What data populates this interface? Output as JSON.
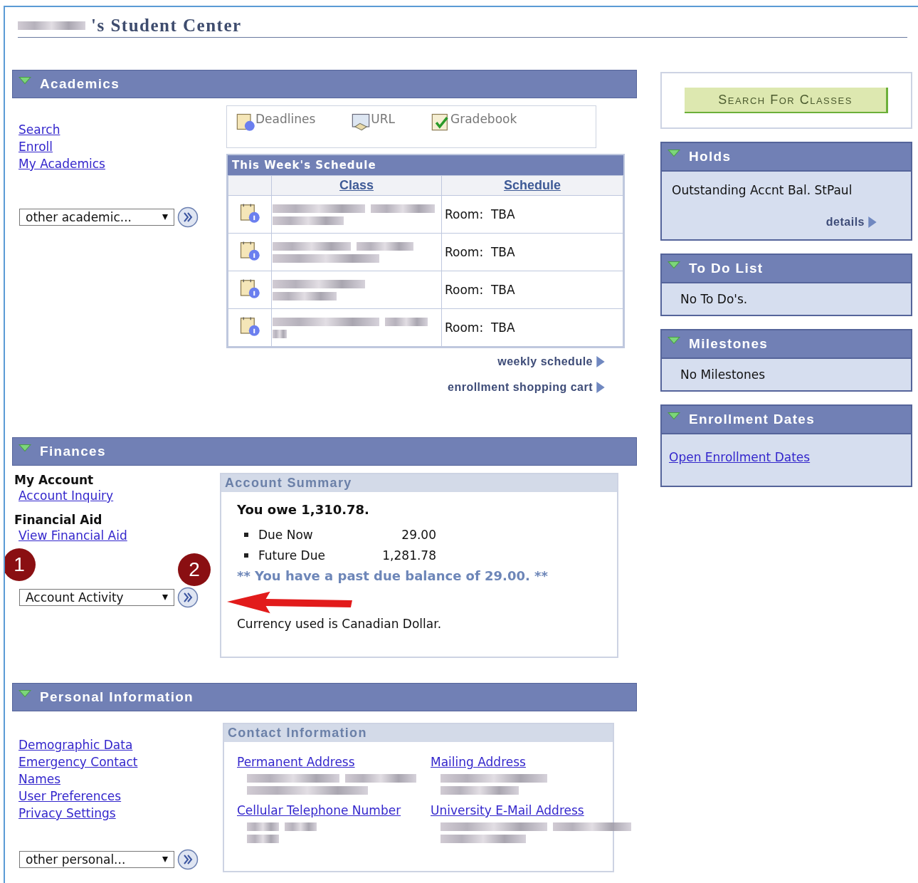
{
  "title": "'s Student Center",
  "academics": {
    "heading": "Academics",
    "links": [
      "Search",
      "Enroll",
      "My Academics"
    ],
    "dropdown": "other academic...",
    "toolbar": [
      {
        "kind": "deadlines",
        "label": "Deadlines"
      },
      {
        "kind": "url",
        "label": "URL"
      },
      {
        "kind": "gradebook",
        "label": "Gradebook"
      }
    ],
    "schedule": {
      "title": "This Week's Schedule",
      "columns": [
        "Class",
        "Schedule"
      ],
      "rows": [
        {
          "schedule": "Room:  TBA"
        },
        {
          "schedule": "Room:  TBA"
        },
        {
          "schedule": "Room:  TBA"
        },
        {
          "schedule": "Room:  TBA"
        }
      ]
    },
    "more_links": [
      "weekly schedule",
      "enrollment shopping cart"
    ]
  },
  "finances": {
    "heading": "Finances",
    "groups": [
      {
        "title": "My Account",
        "link": "Account Inquiry"
      },
      {
        "title": "Financial Aid",
        "link": "View Financial Aid"
      }
    ],
    "dropdown": "Account Activity",
    "summary": {
      "title": "Account Summary",
      "owe": "You owe 1,310.78.",
      "items": [
        {
          "label": "Due Now",
          "amount": "29.00"
        },
        {
          "label": "Future Due",
          "amount": "1,281.78"
        }
      ],
      "warning": "** You have a past due balance of 29.00. **",
      "currency": "Currency used is Canadian Dollar."
    }
  },
  "personal": {
    "heading": "Personal Information",
    "links": [
      "Demographic Data",
      "Emergency Contact",
      "Names",
      "User Preferences",
      "Privacy Settings"
    ],
    "dropdown": "other personal...",
    "contact": {
      "title": "Contact Information",
      "items": [
        "Permanent Address",
        "Mailing Address",
        "Cellular Telephone Number",
        "University E-Mail Address"
      ]
    }
  },
  "sidebar": {
    "search_button": "Search For Classes",
    "panels": [
      {
        "kind": "holds",
        "heading": "Holds",
        "text": "Outstanding Accnt Bal. StPaul",
        "link": "details"
      },
      {
        "kind": "text",
        "heading": "To Do List",
        "text": "No To Do's."
      },
      {
        "kind": "text",
        "heading": "Milestones",
        "text": "No Milestones"
      },
      {
        "kind": "link",
        "heading": "Enrollment Dates",
        "link": "Open Enrollment Dates"
      }
    ]
  },
  "annotations": [
    "1",
    "2"
  ]
}
